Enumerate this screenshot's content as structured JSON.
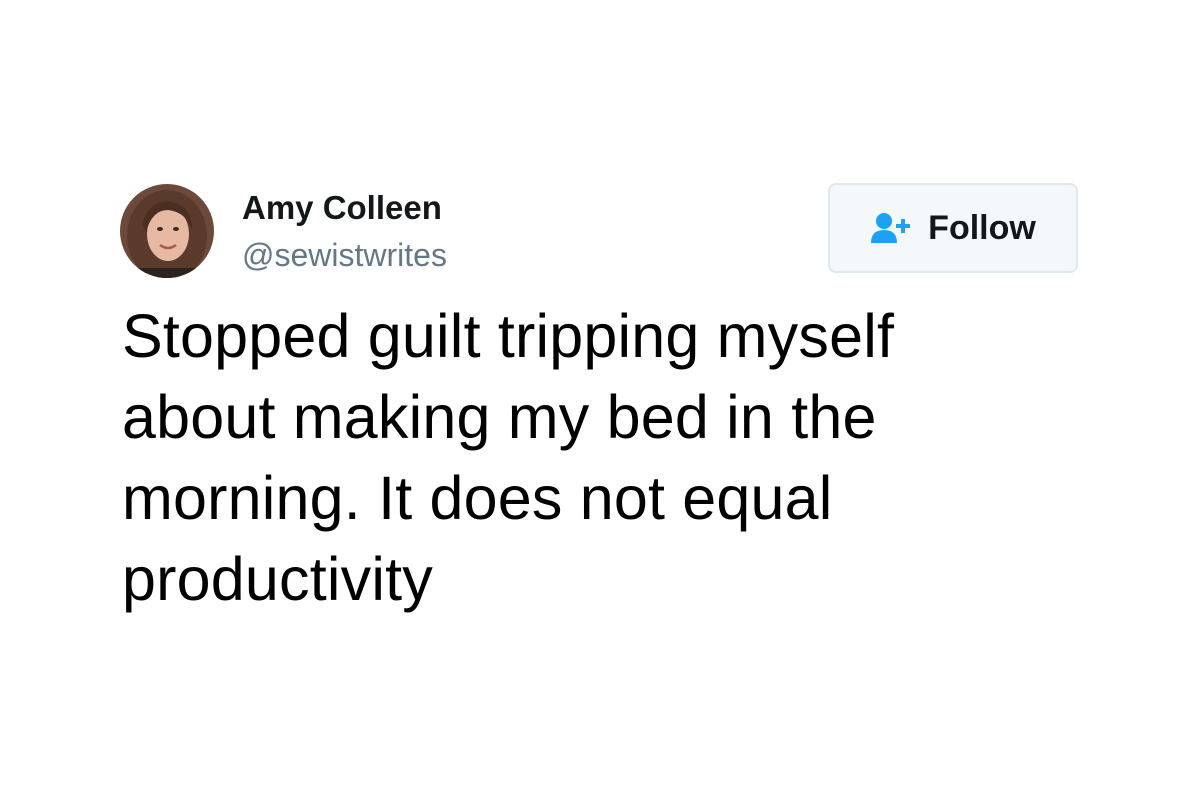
{
  "author": {
    "display_name": "Amy Colleen",
    "handle": "@sewistwrites"
  },
  "follow_button": {
    "label": "Follow",
    "icon": "add-user-icon",
    "icon_color": "#1da1f2"
  },
  "tweet": {
    "text_lines": [
      "Stopped guilt tripping myself",
      "about making my bed in the",
      "morning. It does not equal",
      "productivity"
    ]
  },
  "colors": {
    "background": "#ffffff",
    "name": "#14171a",
    "handle": "#657786",
    "body_text": "#000000",
    "button_bg": "#f5f8fa",
    "button_border": "#e1e8ed"
  }
}
